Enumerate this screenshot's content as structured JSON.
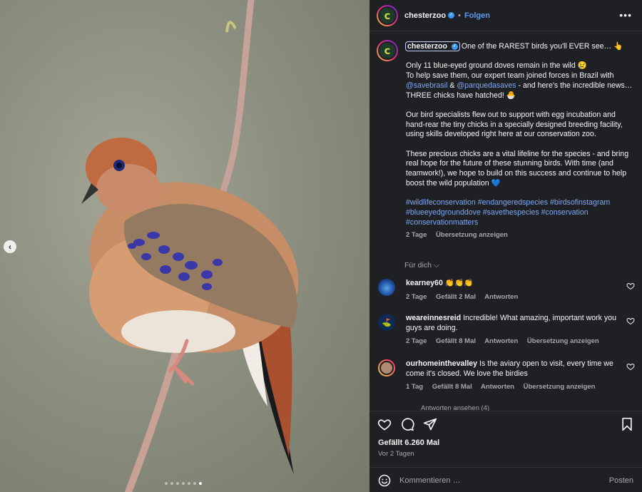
{
  "post": {
    "username": "chesterzoo",
    "follow_label": "Folgen",
    "separator": "•",
    "more_label": "•••",
    "avatar_letter": "c"
  },
  "caption": {
    "headline": "One of the RAREST birds you'll EVER see… 👆",
    "line1": "Only 11 blue-eyed ground doves remain in the wild 😢",
    "line2_a": "To help save them, our expert team joined forces in Brazil with ",
    "mention1": "@savebrasil",
    "amp": " & ",
    "mention2": "@parquedasaves",
    "line2_b": " - and here's the incredible news…THREE chicks have hatched! 🐣",
    "para2": "Our bird specialists flew out to support with egg incubation and hand-rear the tiny chicks in a specially designed breeding facility, using skills developed right here at our conservation zoo.",
    "para3": "These precious chicks are a vital lifeline for the species - and bring real hope for the future of these stunning birds. With time (and teamwork!), we hope to build on this success and continue to help boost the wild population 💙",
    "hashtags": "#wildlifeconservation #endangeredspecies #birdsofinstagram #blueeyedgrounddove #savethespecies #conservation #conservationmatters",
    "age": "2 Tage",
    "translate": "Übersetzung anzeigen"
  },
  "sort_label": "Für dich ⌵",
  "comments": [
    {
      "user": "kearney60",
      "text": "👏👏👏",
      "age": "2 Tage",
      "likes": "Gefällt 2 Mal",
      "reply": "Antworten",
      "translate": ""
    },
    {
      "user": "weareinnesreid",
      "text": "Incredible! What amazing, important work you guys are doing.",
      "age": "2 Tage",
      "likes": "Gefällt 8 Mal",
      "reply": "Antworten",
      "translate": "Übersetzung anzeigen"
    },
    {
      "user": "ourhomeinthevalley",
      "text": "Is the aviary open to visit, every time we come it's closed. We love the birdies",
      "age": "1 Tag",
      "likes": "Gefällt 8 Mal",
      "reply": "Antworten",
      "translate": "Übersetzung anzeigen"
    }
  ],
  "view_replies": "Antworten ansehen (4)",
  "footer": {
    "likes": "Gefällt 6.260 Mal",
    "date": "Vor 2 Tagen",
    "comment_placeholder": "Kommentieren …",
    "post_label": "Posten"
  },
  "carousel": {
    "total": 7,
    "active_index": 6
  },
  "colors": {
    "panel_bg": "#1f2024",
    "link": "#7ea8f5",
    "muted": "#a8a8a8",
    "follow": "#5b9cf0"
  }
}
